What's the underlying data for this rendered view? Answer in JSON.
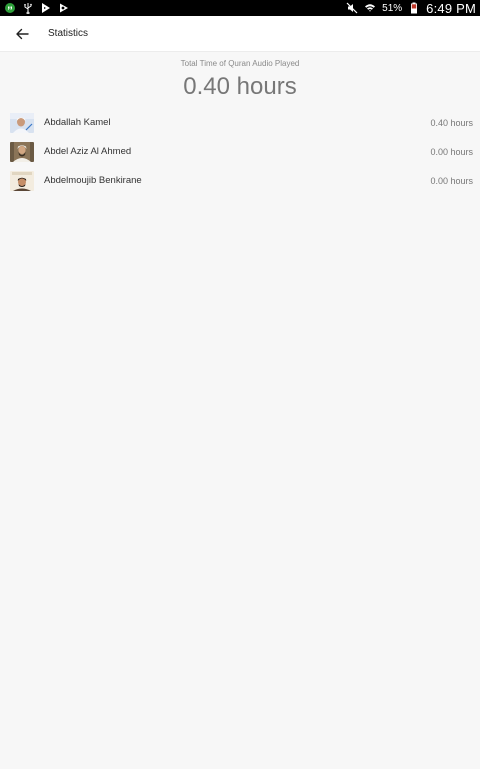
{
  "status_bar": {
    "battery_percent": "51%",
    "time": "6:49 PM",
    "left_icons": [
      "hangouts-icon",
      "usb-icon",
      "play-store-icon",
      "play-music-icon"
    ],
    "right_icons": [
      "mute-icon",
      "wifi-icon",
      "battery-icon"
    ]
  },
  "app_bar": {
    "title": "Statistics"
  },
  "summary": {
    "label": "Total Time of Quran Audio Played",
    "value": "0.40 hours"
  },
  "reciters": [
    {
      "name": "Abdallah Kamel",
      "hours": "0.40 hours"
    },
    {
      "name": "Abdel Aziz Al Ahmed",
      "hours": "0.00 hours"
    },
    {
      "name": "Abdelmoujib Benkirane",
      "hours": "0.00 hours"
    }
  ],
  "colors": {
    "background": "#f7f7f7",
    "status_bar": "#000000",
    "app_bar": "#ffffff"
  }
}
